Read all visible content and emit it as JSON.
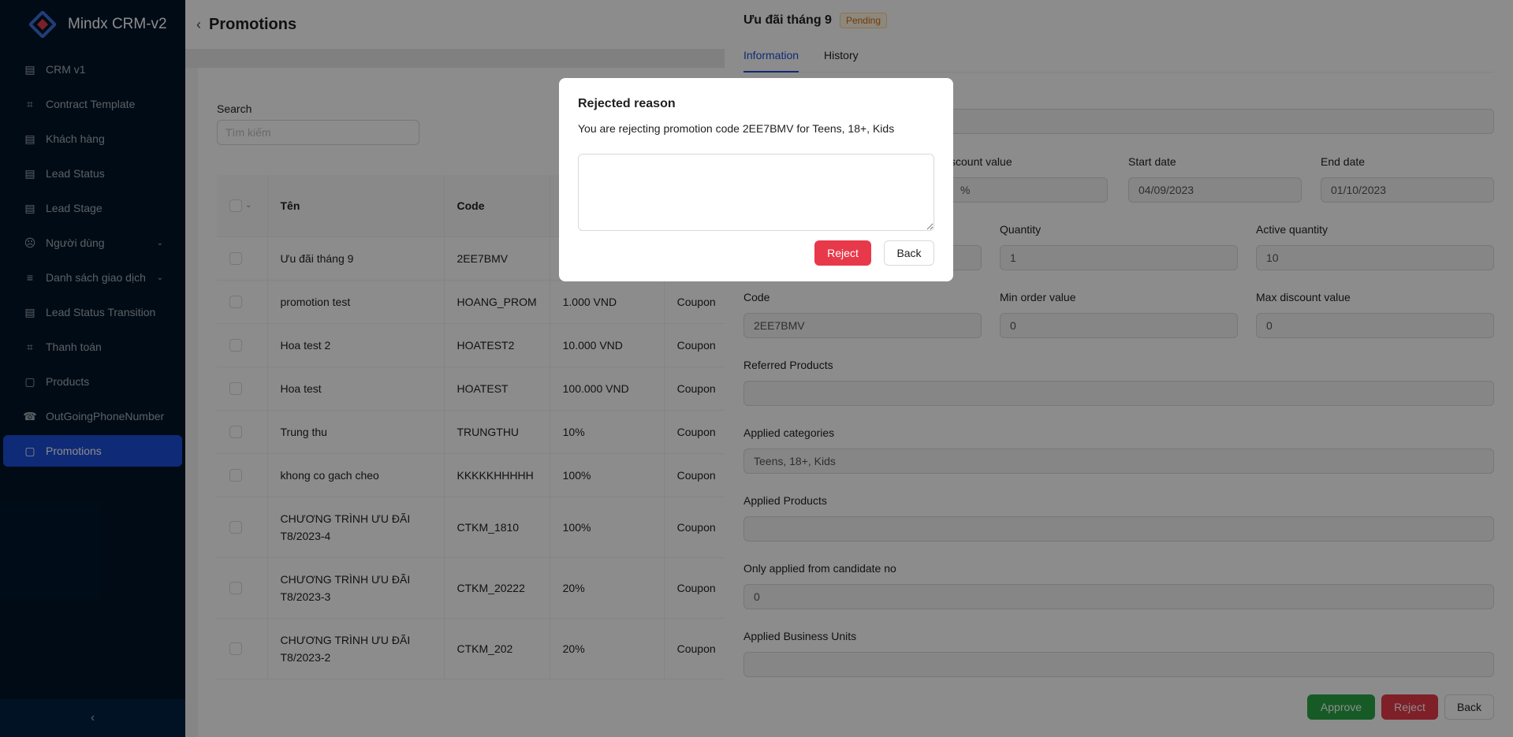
{
  "app": {
    "title": "Mindx CRM-v2"
  },
  "sidebar": {
    "items": [
      {
        "label": "CRM v1",
        "icon": "id-card-icon",
        "chevron": false,
        "active": false
      },
      {
        "label": "Contract Template",
        "icon": "cart-icon",
        "chevron": false,
        "active": false
      },
      {
        "label": "Khách hàng",
        "icon": "id-card-icon",
        "chevron": false,
        "active": false
      },
      {
        "label": "Lead Status",
        "icon": "id-card-icon",
        "chevron": false,
        "active": false
      },
      {
        "label": "Lead Stage",
        "icon": "id-card-icon",
        "chevron": false,
        "active": false
      },
      {
        "label": "Người dùng",
        "icon": "user-icon",
        "chevron": true,
        "active": false
      },
      {
        "label": "Danh sách giao dịch",
        "icon": "menu-lines-icon",
        "chevron": true,
        "active": false
      },
      {
        "label": "Lead Status Transition",
        "icon": "id-card-icon",
        "chevron": false,
        "active": false
      },
      {
        "label": "Thanh toán",
        "icon": "cart-icon",
        "chevron": false,
        "active": false
      },
      {
        "label": "Products",
        "icon": "shopping-bag-icon",
        "chevron": false,
        "active": false
      },
      {
        "label": "OutGoingPhoneNumber",
        "icon": "phone-icon",
        "chevron": false,
        "active": false
      },
      {
        "label": "Promotions",
        "icon": "shopping-bag-icon",
        "chevron": false,
        "active": true
      }
    ],
    "collapse_icon": "chevron-left-icon"
  },
  "page": {
    "title": "Promotions",
    "search": {
      "label": "Search",
      "placeholder": "Tìm kiếm"
    },
    "table": {
      "columns": [
        "Tên",
        "Code",
        "",
        ""
      ],
      "rows": [
        {
          "name": "Ưu đãi tháng 9",
          "code": "2EE7BMV",
          "value": "",
          "type": ""
        },
        {
          "name": "promotion test",
          "code": "HOANG_PROM",
          "value": "1.000 VND",
          "type": "Coupon"
        },
        {
          "name": "Hoa test 2",
          "code": "HOATEST2",
          "value": "10.000 VND",
          "type": "Coupon"
        },
        {
          "name": "Hoa test",
          "code": "HOATEST",
          "value": "100.000 VND",
          "type": "Coupon"
        },
        {
          "name": "Trung thu",
          "code": "TRUNGTHU",
          "value": "10%",
          "type": "Coupon"
        },
        {
          "name": "khong co gach cheo",
          "code": "KKKKKHHHHH",
          "value": "100%",
          "type": "Coupon"
        },
        {
          "name": "CHƯƠNG TRÌNH ƯU ĐÃI T8/2023-4",
          "code": "CTKM_1810",
          "value": "100%",
          "type": "Coupon"
        },
        {
          "name": "CHƯƠNG TRÌNH ƯU ĐÃI T8/2023-3",
          "code": "CTKM_20222",
          "value": "20%",
          "type": "Coupon"
        },
        {
          "name": "CHƯƠNG TRÌNH ƯU ĐÃI T8/2023-2",
          "code": "CTKM_202",
          "value": "20%",
          "type": "Coupon"
        }
      ]
    }
  },
  "drawer": {
    "title": "Ưu đãi tháng 9",
    "status": "Pending",
    "tabs": [
      "Information",
      "History"
    ],
    "fields": {
      "discount_value_label": "scount value",
      "discount_value": "%",
      "start_date_label": "Start date",
      "start_date": "04/09/2023",
      "end_date_label": "End date",
      "end_date": "01/10/2023",
      "quantity_label": "Quantity",
      "quantity": "1",
      "active_quantity_label": "Active quantity",
      "active_quantity": "10",
      "code_label": "Code",
      "code": "2EE7BMV",
      "min_order_label": "Min order value",
      "min_order": "0",
      "max_discount_label": "Max discount value",
      "max_discount": "0",
      "referred_products_label": "Referred Products",
      "referred_products": "",
      "applied_categories_label": "Applied categories",
      "applied_categories": "Teens, 18+, Kids",
      "applied_products_label": "Applied Products",
      "applied_products": "",
      "candidate_label": "Only applied from candidate no",
      "candidate": "0",
      "business_units_label": "Applied Business Units",
      "business_units": ""
    },
    "buttons": {
      "approve": "Approve",
      "reject": "Reject",
      "back": "Back"
    }
  },
  "modal": {
    "title": "Rejected reason",
    "message": "You are rejecting promotion code 2EE7BMV for Teens, 18+, Kids",
    "textarea_value": "",
    "reject_label": "Reject",
    "back_label": "Back"
  }
}
